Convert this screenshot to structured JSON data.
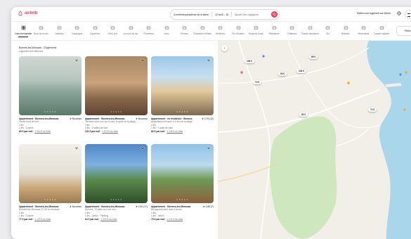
{
  "header": {
    "logo_text": "airbnb",
    "search_location": "Cornerbarsyoulaterav de la sante",
    "search_dates": "12 août – 18",
    "search_guests": "Ajouter des voyageurs",
    "host_text": "Mettre mon logement sur Airbnb"
  },
  "categories": [
    {
      "label": "Vues enchantelle",
      "icon": "grid-icon",
      "active": true
    },
    {
      "label": "Bord de la mer",
      "icon": "wave-icon"
    },
    {
      "label": "Cabanes",
      "icon": "cabin-icon"
    },
    {
      "label": "Campagne",
      "icon": "tree-icon"
    },
    {
      "label": "Vignobles",
      "icon": "grape-icon"
    },
    {
      "label": "Avec vue",
      "icon": "mountain-icon"
    },
    {
      "label": "Au bord du lac",
      "icon": "lake-icon"
    },
    {
      "label": "Chambres",
      "icon": "bed-icon"
    },
    {
      "label": "Lacs",
      "icon": "drop-icon"
    },
    {
      "label": "Fermes",
      "icon": "barn-icon"
    },
    {
      "label": "Chambres d'hôtes",
      "icon": "house-icon"
    },
    {
      "label": "Héritières",
      "icon": "castle-icon"
    },
    {
      "label": "Pro Arcades",
      "icon": "pool-icon"
    },
    {
      "label": "Espaces tropic",
      "icon": "palm-icon"
    },
    {
      "label": "Résidence",
      "icon": "building-icon"
    },
    {
      "label": "Châteaux",
      "icon": "tower-icon"
    },
    {
      "label": "Grands domaines",
      "icon": "estate-icon"
    },
    {
      "label": "Ski",
      "icon": "ski-icon"
    },
    {
      "label": "Bateaux",
      "icon": "boat-icon"
    },
    {
      "label": "Minimaliste",
      "icon": "cube-icon"
    },
    {
      "label": "Cuisine équipée",
      "icon": "chef-icon"
    }
  ],
  "filters_label": "Filtres",
  "list_header": {
    "line1": "Bormes-les-Mimosas · 3 logements",
    "line2": "Logement aux alentours"
  },
  "listings": [
    {
      "title": "Appartement · Bormes-les-Mimosas",
      "rating": "★ Nouveau",
      "line1": "Studio bord de mer",
      "line2": "3 lits",
      "line3": "1 lits · Cuisine",
      "price": "69 € par nuit",
      "total": "1 064 € au total"
    },
    {
      "title": "Appartement · Bormes-les-Mimosas",
      "rating": "★ Nouveau",
      "line1": "Terrasse avec vue sur la mer, le golfe de la plage",
      "line2": "3 lits",
      "line3": "3 lits · 2 salles de bain",
      "price": "101 € par nuit",
      "total": "1 576 € au total"
    },
    {
      "title": "Appartement · en résidence · Bormes",
      "rating": "★ 4,75 (12)",
      "line1": "Appartement rénové à 4 min de la plage",
      "line2": "2 lits",
      "line3": "1 lits · 1 salle de bain",
      "price": "80 € par nuit",
      "total": "1 235 € au total"
    },
    {
      "title": "Appartement · Bormes-les-Mimosas",
      "rating": "★ Nouveau",
      "line1": "Bormes les Mimosas T2 45 m² terrasse",
      "line2": "3 lits",
      "line3": "1 lits · Cuisine",
      "price": "77 € par nuit",
      "total": "1 120 € au total"
    },
    {
      "title": "Appartement · Bormes-les-Mimosas",
      "rating": "★ 4,92 (17)",
      "line1": "Bormes, T2 plein sud vue mer",
      "line2": "4 lits",
      "line3": "1 lits · Jardin · Parking",
      "price": "64 € par nuit",
      "total": "1 028 € au total"
    },
    {
      "title": "Appartement · Bormes-les-Mimosas",
      "rating": "★ 4,86 (7)",
      "line1": "Bel appartement face à la mer",
      "line2": "4 lits",
      "line3": "1 lits · Jardin",
      "price": "79 € par nuit",
      "total": "1 244 € au total"
    }
  ],
  "map_pins": [
    {
      "label": "108 €"
    },
    {
      "label": "93 €"
    },
    {
      "label": "104 €"
    },
    {
      "label": "74 €"
    },
    {
      "label": "83 €"
    },
    {
      "label": "89 €"
    },
    {
      "label": "72 €"
    }
  ],
  "colors": {
    "brand": "#ff385c",
    "sea": "#a9d6ea",
    "park": "#cfe7bf",
    "land": "#f2efe9"
  }
}
